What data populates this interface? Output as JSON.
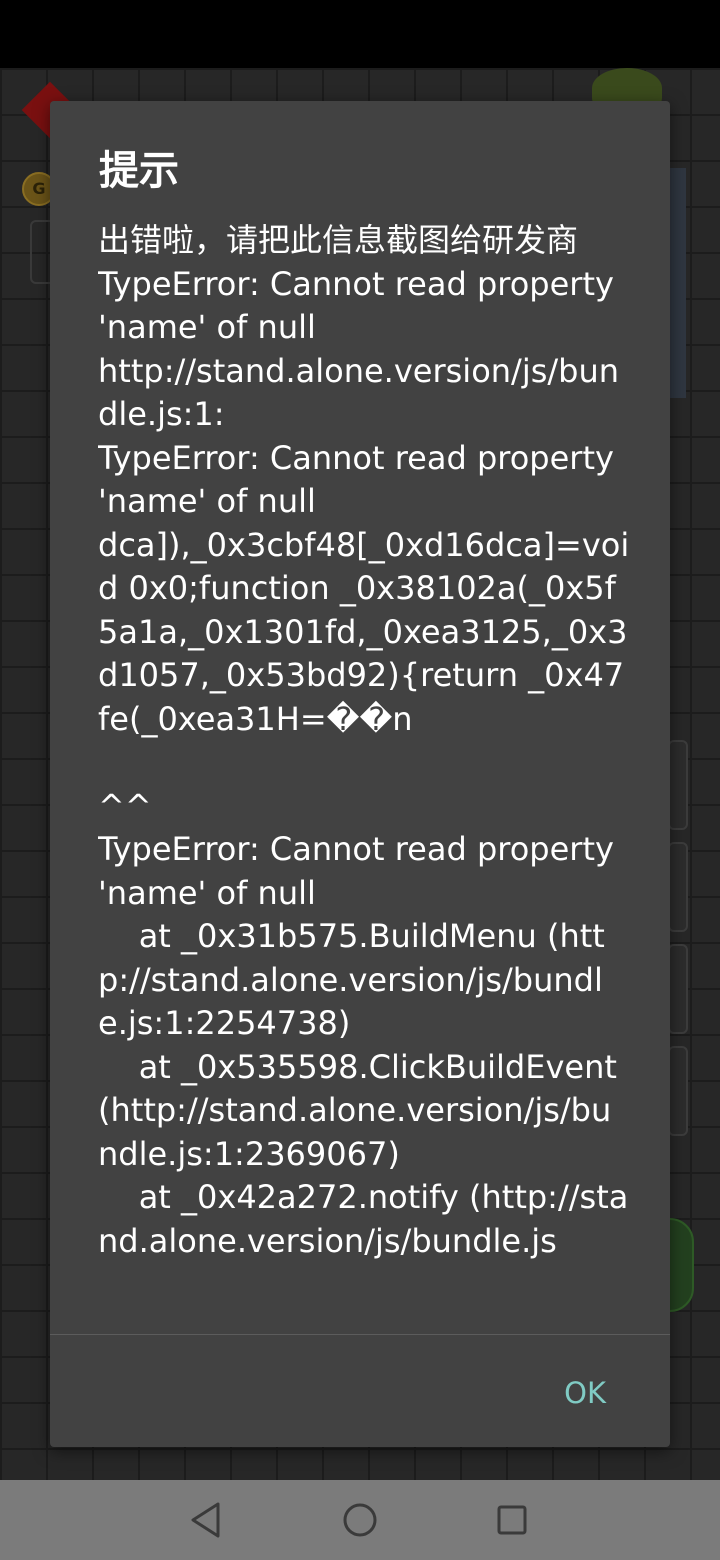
{
  "dialog": {
    "title": "提示",
    "message": "出错啦，请把此信息截图给研发商\nTypeError: Cannot read property 'name' of null\nhttp://stand.alone.version/js/bundle.js:1:\nTypeError: Cannot read property 'name' of null\ndca]),_0x3cbf48[_0xd16dca]=void 0x0;function _0x38102a(_0x5f5a1a,_0x1301fd,_0xea3125,_0x3d1057,_0x53bd92){return _0x47fe(_0xea31H=��n\n\n^^\nTypeError: Cannot read property 'name' of null\n    at _0x31b575.BuildMenu (http://stand.alone.version/js/bundle.js:1:2254738)\n    at _0x535598.ClickBuildEvent (http://stand.alone.version/js/bundle.js:1:2369067)\n    at _0x42a272.notify (http://stand.alone.version/js/bundle.js",
    "ok_label": "OK"
  },
  "navigation_bar": {
    "back_icon": "triangle-back-icon",
    "home_icon": "circle-home-icon",
    "recents_icon": "square-recents-icon"
  },
  "colors": {
    "dialog_background": "#424242",
    "accent": "#80cbc4",
    "nav_bar": "#7b7b7b"
  }
}
